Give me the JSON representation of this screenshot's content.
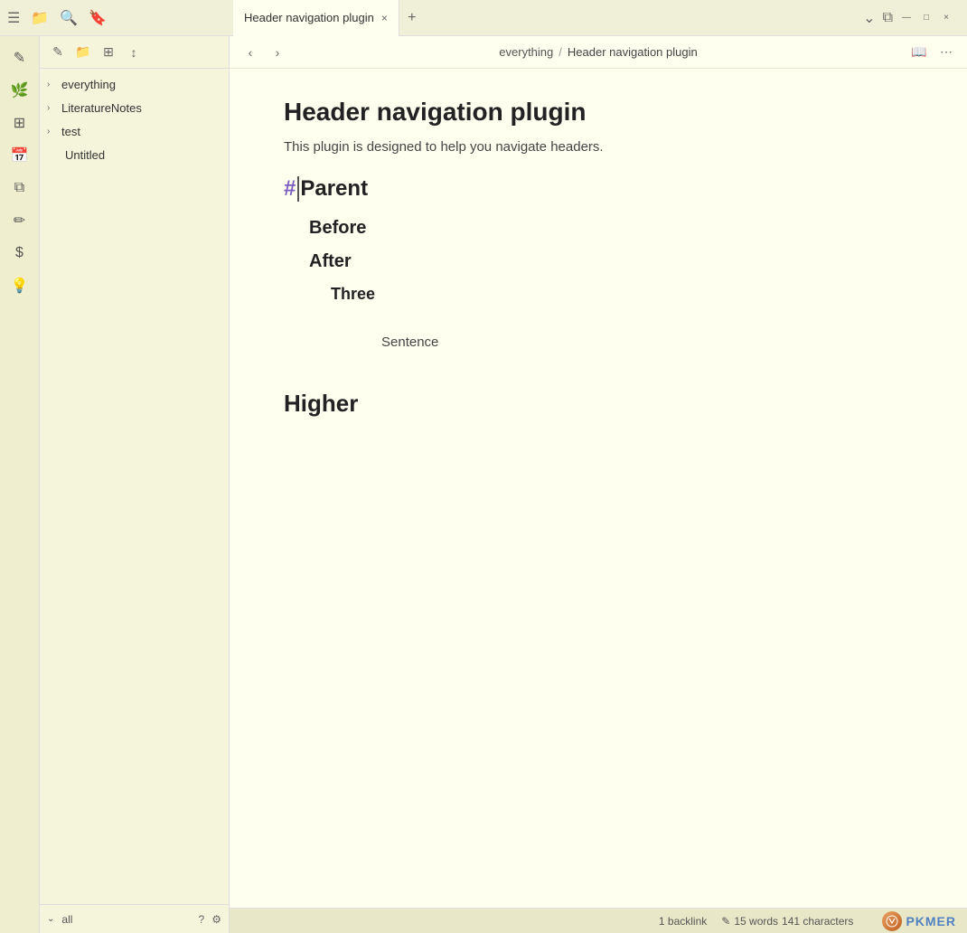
{
  "titlebar": {
    "tab_label": "Header navigation plugin",
    "tab_close": "×",
    "tab_add": "+",
    "chevron_down": "⌄",
    "split_icon": "⧉",
    "minimize": "—",
    "maximize": "□",
    "close": "×"
  },
  "activity_bar": {
    "icons": [
      "☰",
      "📁",
      "🔍",
      "🔖",
      "⚡",
      "🌿",
      "⊞",
      "📅",
      "⧉",
      "✏",
      "$",
      "💡"
    ]
  },
  "sidebar": {
    "toolbar_icons": [
      "✎",
      "📁",
      "⊞",
      "↕"
    ],
    "items": [
      {
        "label": "everything",
        "type": "folder",
        "expanded": true
      },
      {
        "label": "LiteratureNotes",
        "type": "folder",
        "expanded": false
      },
      {
        "label": "test",
        "type": "folder",
        "expanded": false
      },
      {
        "label": "Untitled",
        "type": "file",
        "indent": true
      }
    ],
    "footer_all": "all",
    "footer_help": "?",
    "footer_settings": "⚙"
  },
  "nav": {
    "back": "‹",
    "forward": "›",
    "breadcrumb_parent": "everything",
    "breadcrumb_sep": "/",
    "breadcrumb_current": "Header navigation plugin",
    "reading_view": "📖",
    "more": "⋯"
  },
  "content": {
    "title": "Header navigation plugin",
    "subtitle": "This plugin is designed to help you navigate headers.",
    "h1_hash": "#",
    "h1_text": "Parent",
    "h2_before": "Before",
    "h2_after": "After",
    "h3_three": "Three",
    "h4_sentence": "Sentence",
    "h1_higher": "Higher"
  },
  "statusbar": {
    "backlinks": "1 backlink",
    "pencil_icon": "✎",
    "words": "15 words",
    "characters": "141 characters"
  },
  "pkmer": {
    "logo_text": "PKMER"
  }
}
